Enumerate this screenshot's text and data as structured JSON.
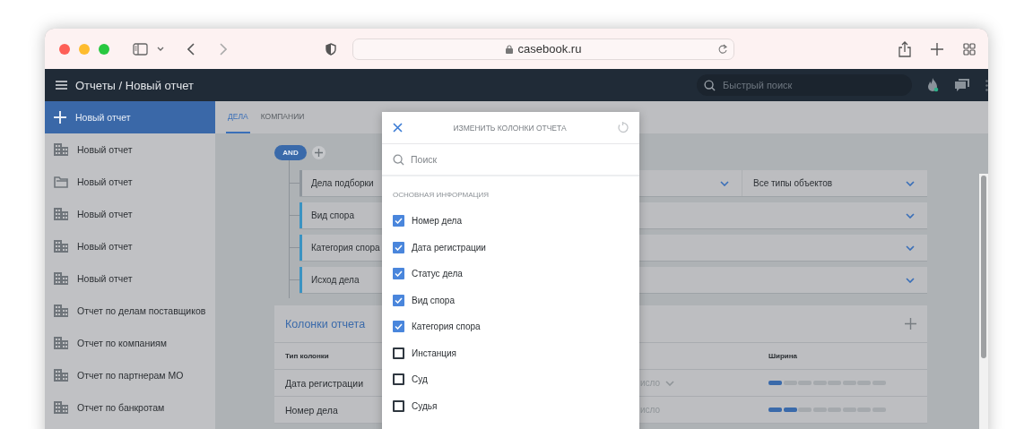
{
  "browser": {
    "url": "casebook.ru"
  },
  "header": {
    "title": "Отчеты / Новый отчет",
    "search": {
      "placeholder": "Быстрый поиск"
    }
  },
  "sidebar": {
    "items": [
      {
        "label": "Новый отчет",
        "kind": "add",
        "selected": true
      },
      {
        "label": "Новый отчет",
        "kind": "building",
        "selected": false
      },
      {
        "label": "Новый отчет",
        "kind": "folder",
        "selected": false
      },
      {
        "label": "Новый отчет",
        "kind": "building",
        "selected": false
      },
      {
        "label": "Новый отчет",
        "kind": "building",
        "selected": false
      },
      {
        "label": "Новый отчет",
        "kind": "building",
        "selected": false
      },
      {
        "label": "Отчет по делам поставщиков",
        "kind": "building",
        "selected": false
      },
      {
        "label": "Отчет по компаниям",
        "kind": "building",
        "selected": false
      },
      {
        "label": "Отчет по партнерам МО",
        "kind": "building",
        "selected": false
      },
      {
        "label": "Отчет по банкротам",
        "kind": "building",
        "selected": false
      }
    ]
  },
  "tabs": [
    {
      "label": "ДЕЛА",
      "selected": true
    },
    {
      "label": "КОМПАНИИ",
      "selected": false
    }
  ],
  "filters": {
    "operator": "AND",
    "rows": [
      {
        "label": "Дела подборки",
        "color": "#8e959c",
        "extra": "Все типы объектов"
      },
      {
        "label": "Вид спора",
        "color": "#3a93c2"
      },
      {
        "label": "Категория спора",
        "color": "#3a93c2"
      },
      {
        "label": "Исход дела",
        "color": "#3a93c2"
      }
    ]
  },
  "columns_card": {
    "title": "Колонки отчета",
    "column_1": "Тип колонки",
    "column_3": "Ширина",
    "rows": [
      {
        "name": "Дата регистрации",
        "format": "исло",
        "dropdown": true,
        "width": {
          "level": 0.125
        }
      },
      {
        "name": "Номер дела",
        "format": "исло",
        "dropdown": false,
        "width": {
          "level": 0.25
        }
      }
    ]
  },
  "modal": {
    "title": "ИЗМЕНИТЬ КОЛОНКИ ОТЧЕТА",
    "search": {
      "placeholder": "Поиск"
    },
    "section": "ОСНОВНАЯ ИНФОРМАЦИЯ",
    "items": [
      {
        "label": "Номер дела",
        "checked": true
      },
      {
        "label": "Дата регистрации",
        "checked": true
      },
      {
        "label": "Статус дела",
        "checked": true
      },
      {
        "label": "Вид спора",
        "checked": true
      },
      {
        "label": "Категория спора",
        "checked": true
      },
      {
        "label": "Инстанция",
        "checked": false
      },
      {
        "label": "Суд",
        "checked": false
      },
      {
        "label": "Судья",
        "checked": false
      }
    ]
  }
}
